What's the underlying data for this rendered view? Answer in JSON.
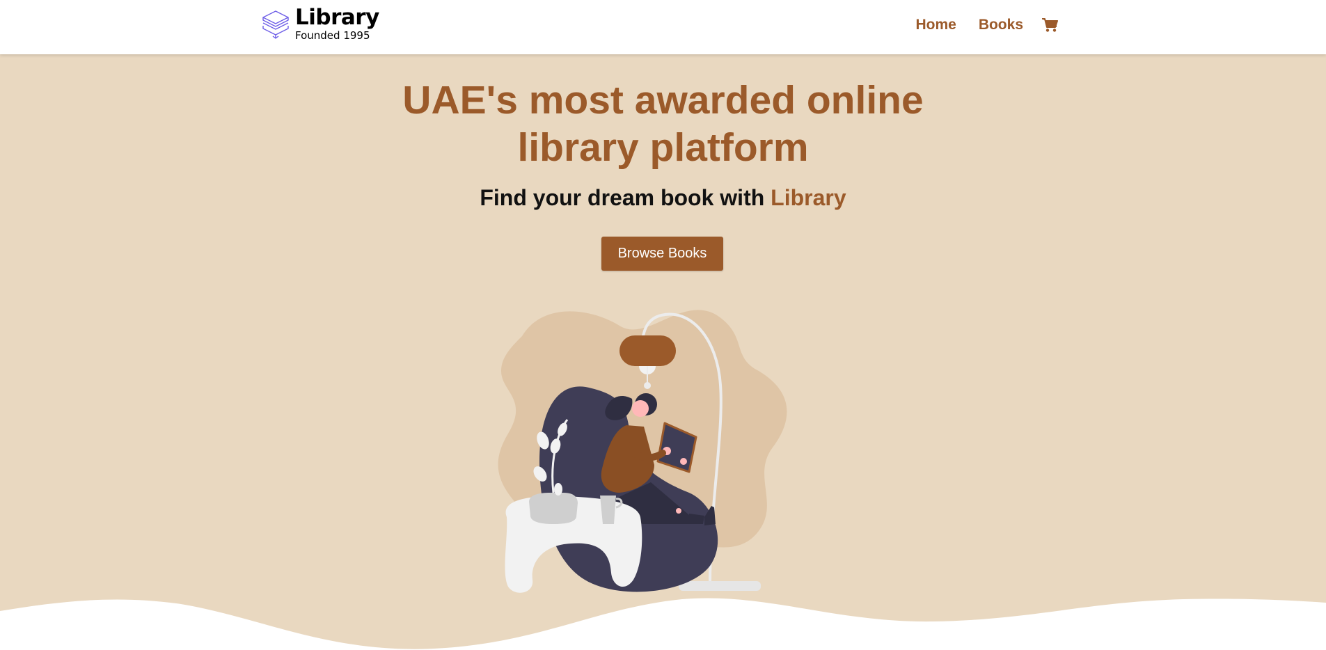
{
  "brand": {
    "name": "Library",
    "tagline": "Founded 1995",
    "icon": "stacked-books-icon"
  },
  "nav": {
    "items": [
      {
        "label": "Home"
      },
      {
        "label": "Books"
      }
    ],
    "cart_icon": "cart-icon"
  },
  "hero": {
    "headline_line1": "UAE's most awarded online",
    "headline_line2": "library platform",
    "subtitle_prefix": "Find your dream book with ",
    "subtitle_accent": "Library",
    "cta_label": "Browse Books",
    "illustration": "woman-reading-in-beanbag-illustration"
  },
  "colors": {
    "accent": "#9b5a2a",
    "hero_background": "#e9d8c0",
    "blob": "#dfc5a6",
    "beanbag": "#3f3d56",
    "logo_icon": "#6c5ce7"
  }
}
